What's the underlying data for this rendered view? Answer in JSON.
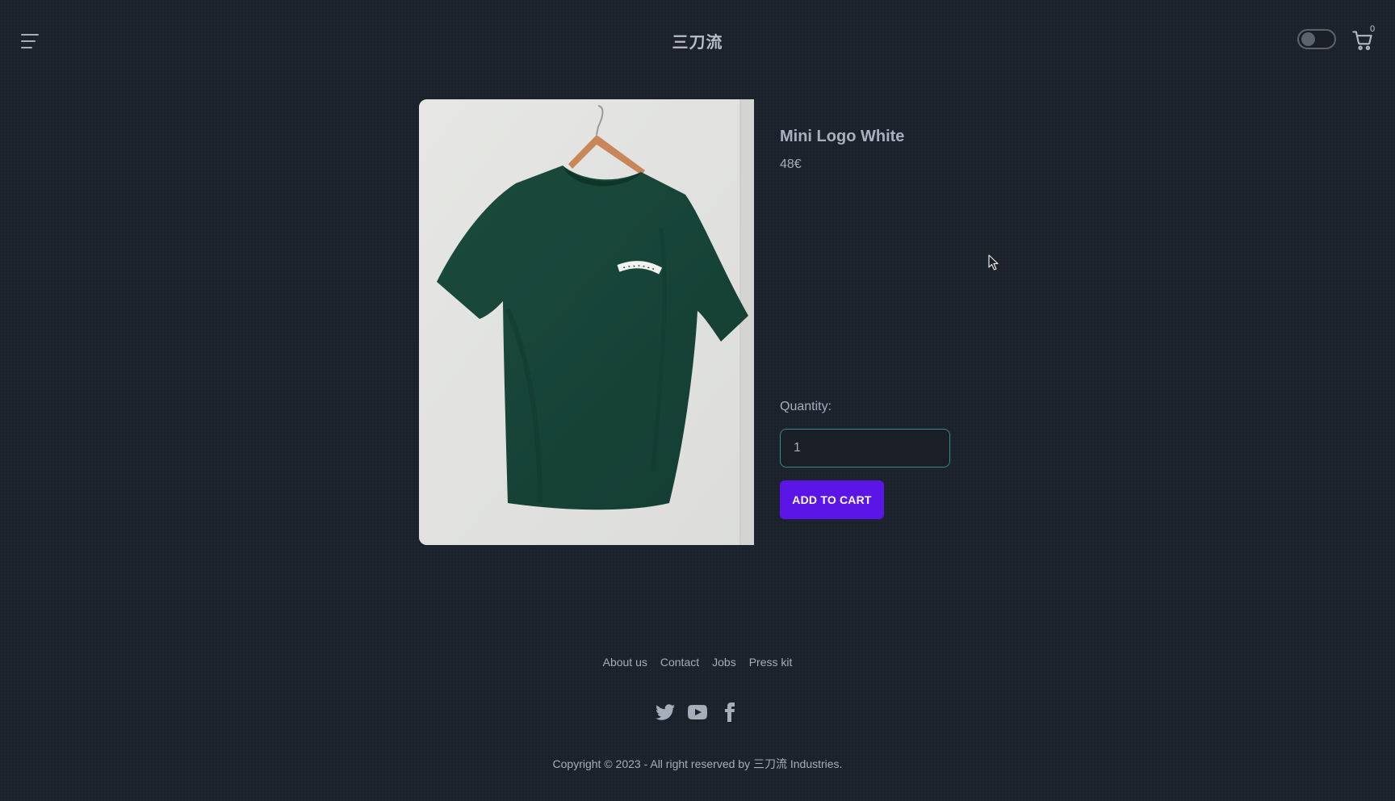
{
  "header": {
    "brand": "三刀流",
    "menu_icon": "hamburger-menu-icon",
    "theme_toggle": {
      "state": "off"
    },
    "cart": {
      "icon": "shopping-cart-icon",
      "count": "0"
    }
  },
  "product": {
    "image": {
      "subject": "green t-shirt on hanger",
      "print": "CARHARTT"
    },
    "title": "Mini Logo White",
    "price": "48€",
    "quantity_label": "Quantity:",
    "quantity_value": "1",
    "add_to_cart_label": "ADD TO CART"
  },
  "footer": {
    "links": [
      "About us",
      "Contact",
      "Jobs",
      "Press kit"
    ],
    "social": [
      "twitter-icon",
      "youtube-icon",
      "facebook-icon"
    ],
    "copyright": "Copyright © 2023 - All right reserved by 三刀流 Industries."
  },
  "colors": {
    "background": "#1c222c",
    "text": "#a6adbb",
    "accent_button": "#5b15e6",
    "input_border": "#2f8f86",
    "shirt": "#17473a"
  }
}
